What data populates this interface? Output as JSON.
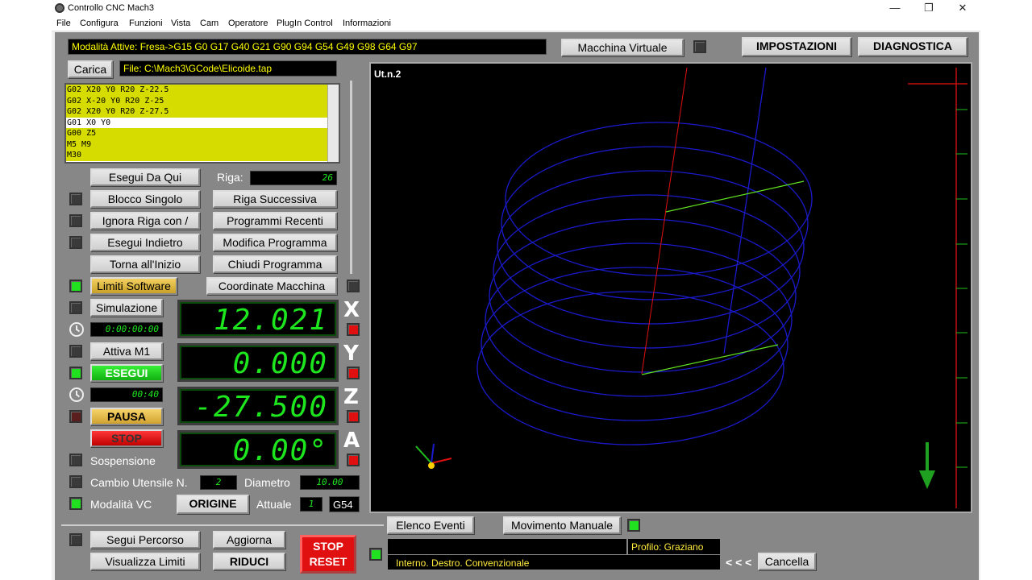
{
  "window": {
    "title": "Controllo CNC Mach3",
    "min_icon": "minimize-icon",
    "max_icon": "restore-icon",
    "close_icon": "close-icon",
    "min_glyph": "—",
    "max_glyph": "❐",
    "close_glyph": "✕"
  },
  "menu": [
    "File",
    "Configura",
    "Funzioni",
    "Vista",
    "Cam",
    "Operatore",
    "PlugIn Control",
    "Informazioni"
  ],
  "header": {
    "modalities": "Modalità Attive: Fresa->G15  G0 G17 G40 G21 G90 G94 G54 G49 G98 G64 G97",
    "virtual_machine": "Macchina Virtuale",
    "settings": "IMPOSTAZIONI",
    "diagnostics": "DIAGNOSTICA"
  },
  "file": {
    "load_button": "Carica",
    "path": "File: C:\\Mach3\\GCode\\Elicoide.tap"
  },
  "gcode_lines": [
    "G02 X20 Y0 R20 Z-22.5",
    "G02 X-20 Y0 R20 Z-25",
    "G02 X20 Y0 R20 Z-27.5",
    "G01 X0 Y0",
    "G00 Z5",
    "M5 M9",
    "M30"
  ],
  "current_line_index": 3,
  "program": {
    "run_from_here": "Esegui Da Qui",
    "line_label": "Riga:",
    "line_value": "26",
    "single_block": "Blocco Singolo",
    "next_line": "Riga Successiva",
    "ignore_line": "Ignora Riga con /",
    "recent": "Programmi Recenti",
    "run_back": "Esegui Indietro",
    "edit": "Modifica Programma",
    "rewind": "Torna all'Inizio",
    "close": "Chiudi Programma",
    "soft_limits": "Limiti Software",
    "machine_coords": "Coordinate Macchina",
    "simulation": "Simulazione",
    "sim_time": "0:00:00:00",
    "activate_m1": "Attiva M1",
    "cycle_start": "ESEGUI",
    "run_time": "00:40",
    "feed_hold": "PAUSA",
    "stop": "STOP",
    "suspend": "Sospensione",
    "tool_change": "Cambio Utensile N.",
    "tool_number": "2",
    "diameter_label": "Diametro",
    "diameter_value": "10.00",
    "vc_mode": "Modalità VC",
    "origin": "ORIGINE",
    "current_label": "Attuale",
    "current_value": "1",
    "work_offset": "G54"
  },
  "dro": {
    "x": "12.021",
    "y": "0.000",
    "z": "-27.500",
    "a": "0.00°",
    "x_label": "X",
    "y_label": "Y",
    "z_label": "Z",
    "a_label": "A"
  },
  "toolpath": {
    "label": "Ut.n.2"
  },
  "bottom": {
    "follow_path": "Segui Percorso",
    "refresh": "Aggiorna",
    "show_limits": "Visualizza Limiti",
    "reduce": "RIDUCI",
    "stop_reset_1": "STOP",
    "stop_reset_2": "RESET",
    "events_list": "Elenco Eventi",
    "manual_move": "Movimento Manuale",
    "profile": "Profilo: Graziano",
    "status": "Interno. Destro. Convenzionale",
    "arrows": "< < <",
    "cancel": "Cancella"
  },
  "colors": {
    "panel": "#878787",
    "lcd_text": "#ffff00",
    "dro_text": "#1ee61e",
    "path": "#1a1acc",
    "led_on": "#20e020",
    "led_red": "#e01010"
  }
}
